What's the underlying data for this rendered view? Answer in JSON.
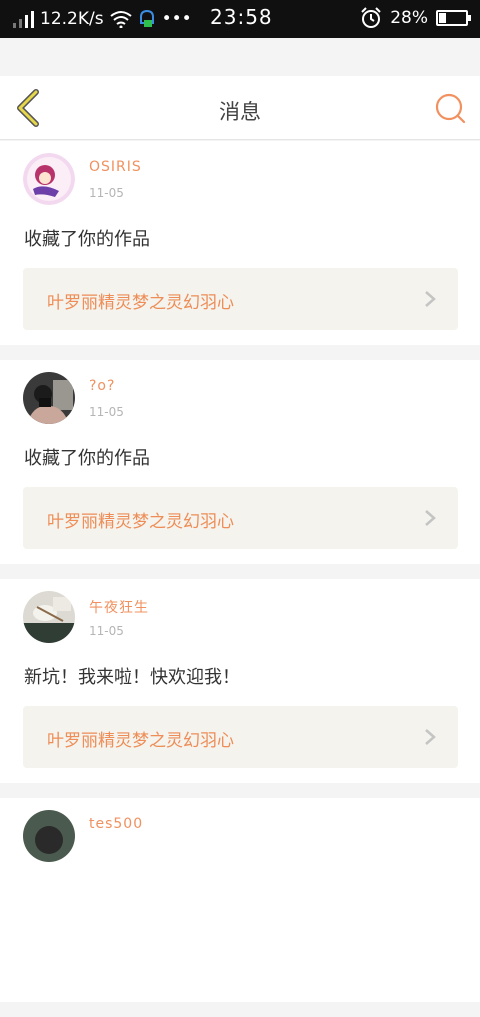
{
  "status_bar": {
    "network_speed": "12.2K/s",
    "time": "23:58",
    "battery": "28%",
    "battery_level": 0.28
  },
  "header": {
    "title": "消息"
  },
  "messages": [
    {
      "username": "OSIRIS",
      "date": "11-05",
      "text": "收藏了你的作品",
      "work_title": "叶罗丽精灵梦之灵幻羽心"
    },
    {
      "username": "?o?",
      "date": "11-05",
      "text": "收藏了你的作品",
      "work_title": "叶罗丽精灵梦之灵幻羽心"
    },
    {
      "username": "午夜狂生",
      "date": "11-05",
      "text": "新坑！我来啦！快欢迎我！",
      "work_title": "叶罗丽精灵梦之灵幻羽心"
    },
    {
      "username": "tes500",
      "date": "",
      "text": "",
      "work_title": ""
    }
  ],
  "colors": {
    "accent": "#f0915f",
    "back_arrow": "#e6d84a",
    "card_bg": "#f4f3ed"
  }
}
